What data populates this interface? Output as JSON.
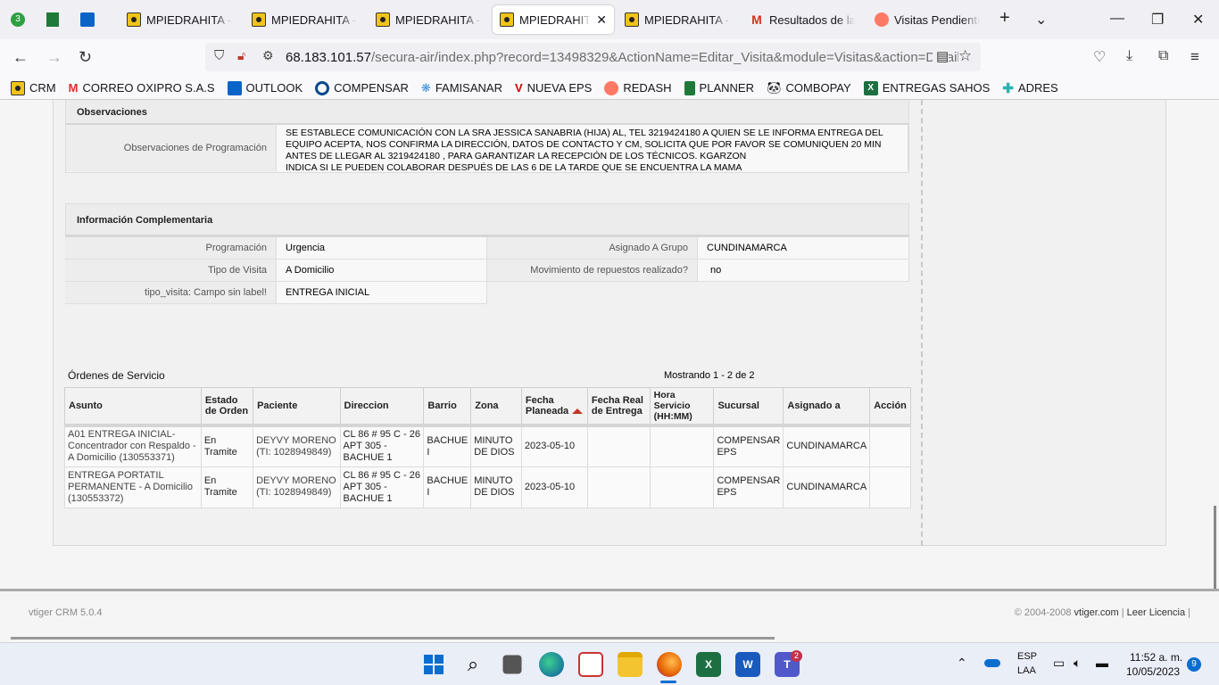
{
  "browser": {
    "tabs": [
      {
        "label": "MPIEDRAHITA - A",
        "icon": "vtiger-icon",
        "active": false
      },
      {
        "label": "MPIEDRAHITA - A",
        "icon": "vtiger-icon",
        "active": false
      },
      {
        "label": "MPIEDRAHITA - A",
        "icon": "vtiger-icon",
        "active": false
      },
      {
        "label": "MPIEDRAHITA -",
        "icon": "vtiger-icon",
        "active": true
      },
      {
        "label": "MPIEDRAHITA - A",
        "icon": "vtiger-icon",
        "active": false
      },
      {
        "label": "Resultados de la b",
        "icon": "gmail-icon",
        "active": false
      },
      {
        "label": "Visitas Pendiente",
        "icon": "redash-icon",
        "active": false
      }
    ],
    "badge_count": "3",
    "url_host": "68.183.101.57",
    "url_path": "/secura-air/index.php?record=13498329&ActionName=Editar_Visita&module=Visitas&action=DetailV",
    "bookmarks": [
      "CRM",
      "CORREO OXIPRO S.A.S",
      "OUTLOOK",
      "COMPENSAR",
      "FAMISANAR",
      "NUEVA EPS",
      "REDASH",
      "PLANNER",
      "COMBOPAY",
      "ENTREGAS SAHOS",
      "ADRES"
    ]
  },
  "observaciones": {
    "title": "Observaciones",
    "label": "Observaciones de Programación",
    "text": " SE ESTABLECE COMUNICACIÓN CON LA SRA JESSICA SANABRIA (HIJA) AL, TEL 3219424180 A QUIEN SE LE INFORMA ENTREGA DEL EQUIPO ACEPTA, NOS CONFIRMA LA DIRECCIÓN, DATOS DE CONTACTO Y CM, SOLICITA QUE POR FAVOR SE COMUNIQUEN 20 MIN ANTES DE LLEGAR AL 3219424180 , PARA GARANTIZAR LA RECEPCIÓN DE LOS TÉCNICOS. KGARZON\n INDICA SI LE PUEDEN COLABORAR DESPUÉS DE LAS 6 DE LA TARDE QUE SE ENCUENTRA LA MAMA"
  },
  "complementaria": {
    "title": "Información Complementaria",
    "programacion_label": "Programación",
    "programacion_value": "Urgencia",
    "asignado_label": "Asignado A Grupo",
    "asignado_value": "CUNDINAMARCA",
    "tipo_label": "Tipo de Visita",
    "tipo_value": "A Domicilio",
    "movimiento_label": "Movimiento de repuestos realizado?",
    "movimiento_value": "no",
    "campo_label": "tipo_visita: Campo sin label!",
    "campo_value": "ENTREGA INICIAL"
  },
  "ordenes": {
    "title": "Órdenes de Servicio",
    "showing": "Mostrando 1 - 2 de 2",
    "columns": [
      "Asunto",
      "Estado de Orden",
      "Paciente",
      "Direccion",
      "Barrio",
      "Zona",
      "Fecha Planeada",
      "Fecha Real de Entrega",
      "Hora Servicio (HH:MM)",
      "Sucursal",
      "Asignado a",
      "Acción"
    ],
    "rows": [
      {
        "asunto": "A01 ENTREGA INICIAL-Concentrador con Respaldo - A Domicilio (130553371)",
        "estado": "En Tramite",
        "paciente": "DEYVY MORENO (TI: 1028949849)",
        "direccion": "CL 86 # 95 C - 26 APT 305 - BACHUE 1",
        "barrio": "BACHUE I",
        "zona": "MINUTO DE DIOS",
        "fecha_planeada": "2023-05-10",
        "fecha_real": "",
        "hora": "",
        "sucursal": "COMPENSAR EPS",
        "asignado": "CUNDINAMARCA",
        "accion": ""
      },
      {
        "asunto": "ENTREGA PORTATIL PERMANENTE - A Domicilio (130553372)",
        "estado": "En Tramite",
        "paciente": "DEYVY MORENO (TI: 1028949849)",
        "direccion": "CL 86 # 95 C - 26 APT 305 - BACHUE 1",
        "barrio": "BACHUE I",
        "zona": "MINUTO DE DIOS",
        "fecha_planeada": "2023-05-10",
        "fecha_real": "",
        "hora": "",
        "sucursal": "COMPENSAR EPS",
        "asignado": "CUNDINAMARCA",
        "accion": ""
      }
    ]
  },
  "footer": {
    "left": "vtiger CRM 5.0.4",
    "copyright": "© 2004-2008",
    "link1": "vtiger.com",
    "sep": "|",
    "link2": "Leer Licencia",
    "sep2": "|"
  },
  "taskbar": {
    "lang1": "ESP",
    "lang2": "LAA",
    "time": "11:52 a. m.",
    "date": "10/05/2023",
    "notif_count": "9",
    "teams_badge": "2"
  },
  "colors": {
    "accent": "#c0392b",
    "vtiger_yellow": "#f0c419"
  }
}
